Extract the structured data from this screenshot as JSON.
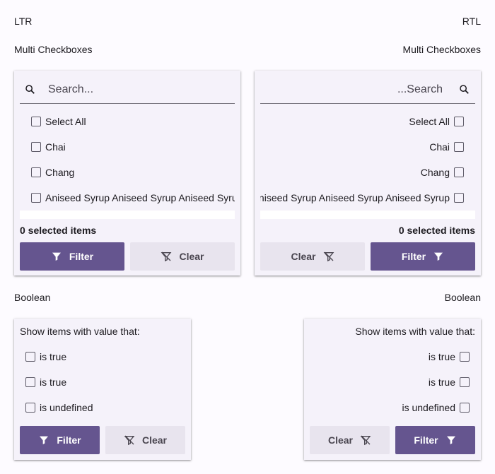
{
  "sections": {
    "ltr_label": "LTR",
    "rtl_label": "RTL"
  },
  "multi_checkboxes": {
    "ltr": {
      "title": "Multi Checkboxes",
      "search_placeholder": "Search...",
      "items": [
        {
          "label": "Select All",
          "checked": false
        },
        {
          "label": "Chai",
          "checked": false
        },
        {
          "label": "Chang",
          "checked": false
        },
        {
          "label": "Aniseed Syrup Aniseed Syrup Aniseed Syrup",
          "checked": false
        }
      ],
      "selected_count": "0 selected items",
      "filter_label": "Filter",
      "clear_label": "Clear"
    },
    "rtl": {
      "title": "Multi Checkboxes",
      "search_placeholder": "Search...",
      "items": [
        {
          "label": "Select All",
          "checked": false
        },
        {
          "label": "Chai",
          "checked": false
        },
        {
          "label": "Chang",
          "checked": false
        },
        {
          "label": "Aniseed Syrup Aniseed Syrup Aniseed Syrup",
          "checked": false
        }
      ],
      "selected_count": "0 selected items",
      "filter_label": "Filter",
      "clear_label": "Clear"
    }
  },
  "boolean": {
    "ltr": {
      "title": "Boolean",
      "header": "Show items with value that:",
      "items": [
        {
          "label": "is true",
          "checked": false
        },
        {
          "label": "is true",
          "checked": false
        },
        {
          "label": "is undefined",
          "checked": false
        }
      ],
      "filter_label": "Filter",
      "clear_label": "Clear"
    },
    "rtl": {
      "title": "Boolean",
      "header": "Show items with value that:",
      "items": [
        {
          "label": "is true",
          "checked": false
        },
        {
          "label": "is true",
          "checked": false
        },
        {
          "label": "is undefined",
          "checked": false
        }
      ],
      "filter_label": "Filter",
      "clear_label": "Clear"
    }
  },
  "icons": {
    "search": "search-icon",
    "filter": "filter-icon",
    "clear": "filter-clear-icon",
    "checkbox": "checkbox-icon"
  },
  "colors": {
    "primary": "#65558f",
    "secondary_button": "#e8e4ee",
    "panel": "#f5f2fa",
    "background": "#fdfbff"
  }
}
